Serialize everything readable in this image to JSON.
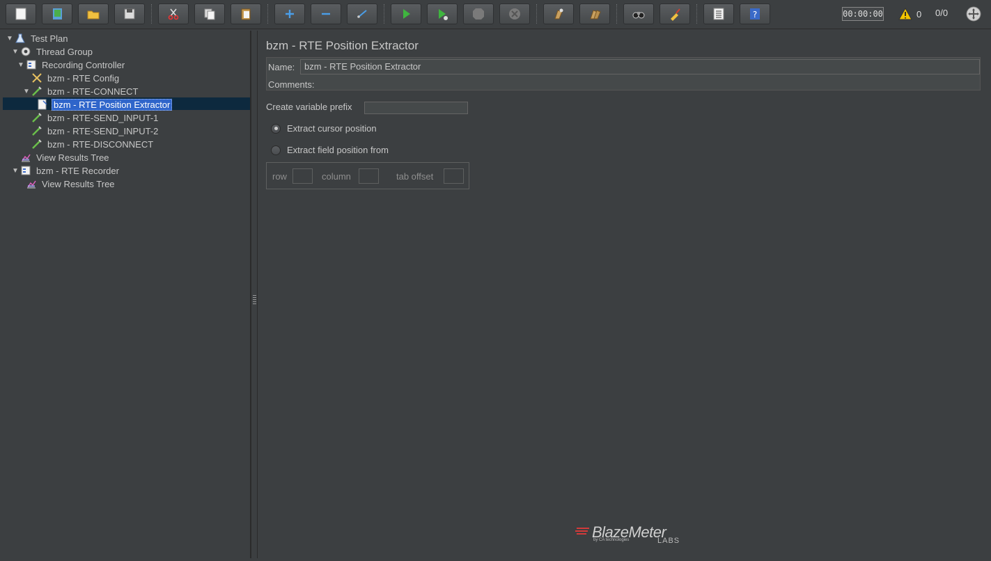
{
  "toolbar": {
    "buttons": [
      "new-icon",
      "templates-icon",
      "open-icon",
      "save-icon",
      "cut-icon",
      "copy-icon",
      "paste-icon",
      "expand-icon",
      "collapse-icon",
      "toggle-icon",
      "start-icon",
      "start-no-pause-icon",
      "stop-icon",
      "shutdown-icon",
      "clear-icon",
      "clear-all-icon",
      "search-icon",
      "reset-search-icon",
      "function-helper-icon",
      "help-icon"
    ],
    "timer": "00:00:00",
    "warnings": "0",
    "threads": "0/0"
  },
  "tree": {
    "items": [
      {
        "label": "Test Plan",
        "icon": "test-plan-icon"
      },
      {
        "label": "Thread Group",
        "icon": "gear-icon"
      },
      {
        "label": "Recording Controller",
        "icon": "controller-icon"
      },
      {
        "label": "bzm - RTE Config",
        "icon": "config-icon"
      },
      {
        "label": "bzm - RTE-CONNECT",
        "icon": "sampler-icon"
      },
      {
        "label": "bzm - RTE Position Extractor",
        "icon": "extractor-icon"
      },
      {
        "label": "bzm - RTE-SEND_INPUT-1",
        "icon": "sampler-icon"
      },
      {
        "label": "bzm - RTE-SEND_INPUT-2",
        "icon": "sampler-icon"
      },
      {
        "label": "bzm - RTE-DISCONNECT",
        "icon": "sampler-icon"
      },
      {
        "label": "View Results Tree",
        "icon": "results-tree-icon"
      },
      {
        "label": "bzm - RTE Recorder",
        "icon": "recorder-icon"
      },
      {
        "label": "View Results Tree",
        "icon": "results-tree-icon"
      }
    ]
  },
  "panel": {
    "title": "bzm - RTE Position Extractor",
    "name_label": "Name:",
    "name_value": "bzm - RTE Position Extractor",
    "comments_label": "Comments:",
    "prefix_label": "Create variable prefix",
    "prefix_value": "",
    "radio_cursor": "Extract cursor position",
    "radio_field": "Extract field position from",
    "selected_mode": "cursor",
    "row_label": "row",
    "column_label": "column",
    "tab_offset_label": "tab offset"
  },
  "logo": {
    "brand": "BlazeMeter",
    "by": "by CA technologies",
    "labs": "LABS"
  },
  "colors": {
    "background": "#3c3f41",
    "selection": "#2f65ca",
    "selected_band": "#0d293e"
  }
}
